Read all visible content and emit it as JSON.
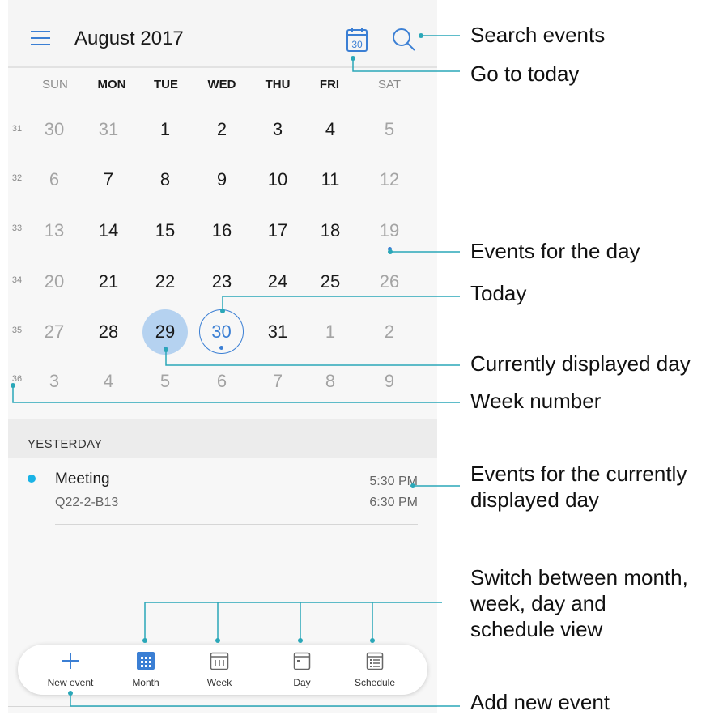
{
  "header": {
    "title": "August 2017",
    "today_icon_text": "30"
  },
  "weekdays": [
    "SUN",
    "MON",
    "TUE",
    "WED",
    "THU",
    "FRI",
    "SAT"
  ],
  "weeks": [
    {
      "number": "31",
      "days": [
        "30",
        "31",
        "1",
        "2",
        "3",
        "4",
        "5"
      ]
    },
    {
      "number": "32",
      "days": [
        "6",
        "7",
        "8",
        "9",
        "10",
        "11",
        "12"
      ]
    },
    {
      "number": "33",
      "days": [
        "13",
        "14",
        "15",
        "16",
        "17",
        "18",
        "19"
      ]
    },
    {
      "number": "34",
      "days": [
        "20",
        "21",
        "22",
        "23",
        "24",
        "25",
        "26"
      ]
    },
    {
      "number": "35",
      "days": [
        "27",
        "28",
        "29",
        "30",
        "31",
        "1",
        "2"
      ]
    },
    {
      "number": "36",
      "days": [
        "3",
        "4",
        "5",
        "6",
        "7",
        "8",
        "9"
      ]
    }
  ],
  "events_section": {
    "label": "YESTERDAY",
    "events": [
      {
        "title": "Meeting",
        "location": "Q22-2-B13",
        "start": "5:30 PM",
        "end": "6:30 PM"
      }
    ]
  },
  "bottom_nav": [
    "New event",
    "Month",
    "Week",
    "Day",
    "Schedule"
  ],
  "annotations": {
    "search": "Search events",
    "today_button": "Go to today",
    "events_day": "Events for the day",
    "today": "Today",
    "current_day": "Currently displayed day",
    "week_number": "Week number",
    "events_current_1": "Events for the currently",
    "events_current_2": "displayed day",
    "switch_1": "Switch between month,",
    "switch_2": "week, day and",
    "switch_3": "schedule view",
    "add_event": "Add new event"
  },
  "colors": {
    "accent": "#3b7fd4",
    "selected_fill": "#b5d2f0",
    "callout": "#2aa7b8",
    "event_dot": "#1ab3e6"
  }
}
